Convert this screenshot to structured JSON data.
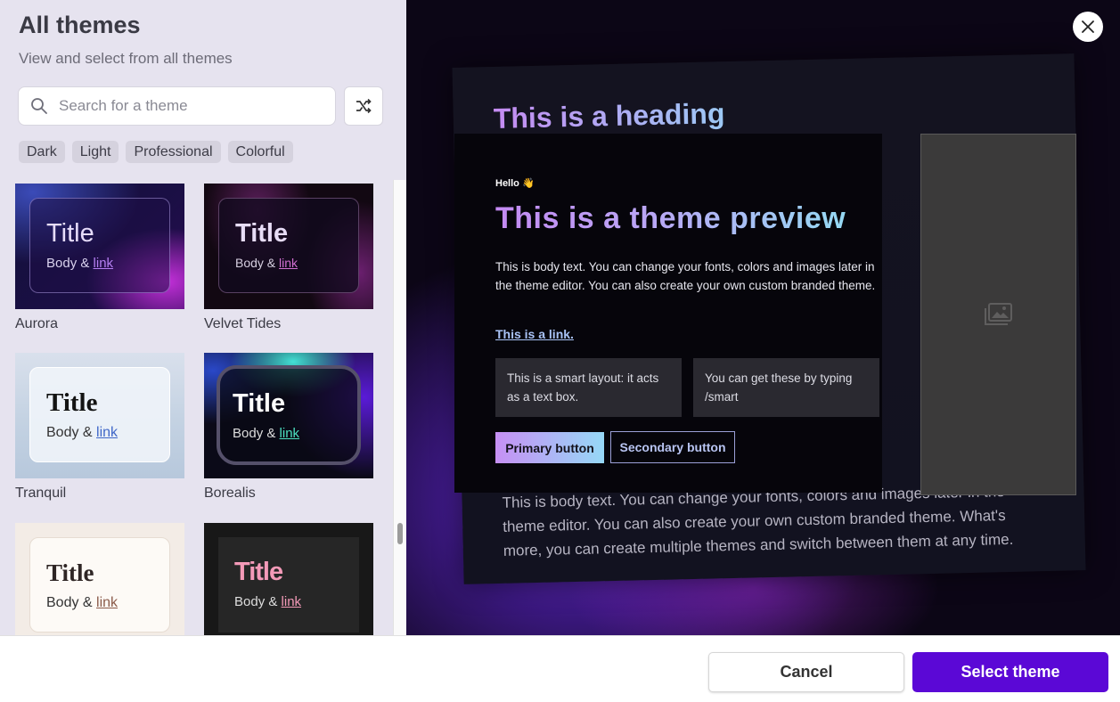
{
  "header": {
    "title": "All themes",
    "subtitle": "View and select from all themes"
  },
  "search": {
    "placeholder": "Search for a theme",
    "value": ""
  },
  "icons": {
    "search": "search-icon",
    "shuffle": "shuffle-icon",
    "close": "close-icon",
    "image": "image-placeholder-icon"
  },
  "filters": [
    "Dark",
    "Light",
    "Professional",
    "Colorful"
  ],
  "themes": [
    {
      "name": "Aurora",
      "title": "Title",
      "body": "Body & ",
      "link": "link"
    },
    {
      "name": "Velvet Tides",
      "title": "Title",
      "body": "Body & ",
      "link": "link"
    },
    {
      "name": "Tranquil",
      "title": "Title",
      "body": "Body & ",
      "link": "link"
    },
    {
      "name": "Borealis",
      "title": "Title",
      "body": "Body & ",
      "link": "link"
    },
    {
      "name": "",
      "title": "Title",
      "body": "Body & ",
      "link": "link"
    },
    {
      "name": "",
      "title": "Title",
      "body": "Body & ",
      "link": "link"
    }
  ],
  "preview": {
    "back_heading": "This is a heading",
    "back_text": "This is body text. You can change your fonts, colors and images later in the theme editor. You can also create your own custom branded theme. What's more, you can create multiple themes and switch between them at any time.",
    "hello": "Hello 👋",
    "heading": "This is a theme preview",
    "body": "This is body text. You can change your fonts, colors and images later in the theme editor. You can also create your own custom branded theme.",
    "link": "This is a link.",
    "smart_left": "This is a smart layout: it acts as a text box.",
    "smart_right": "You can get these by typing /smart",
    "primary_button": "Primary button",
    "secondary_button": "Secondary button"
  },
  "footer": {
    "cancel": "Cancel",
    "select": "Select theme"
  },
  "colors": {
    "accent": "#5b08d6",
    "panel_bg": "#e6e3ef"
  }
}
